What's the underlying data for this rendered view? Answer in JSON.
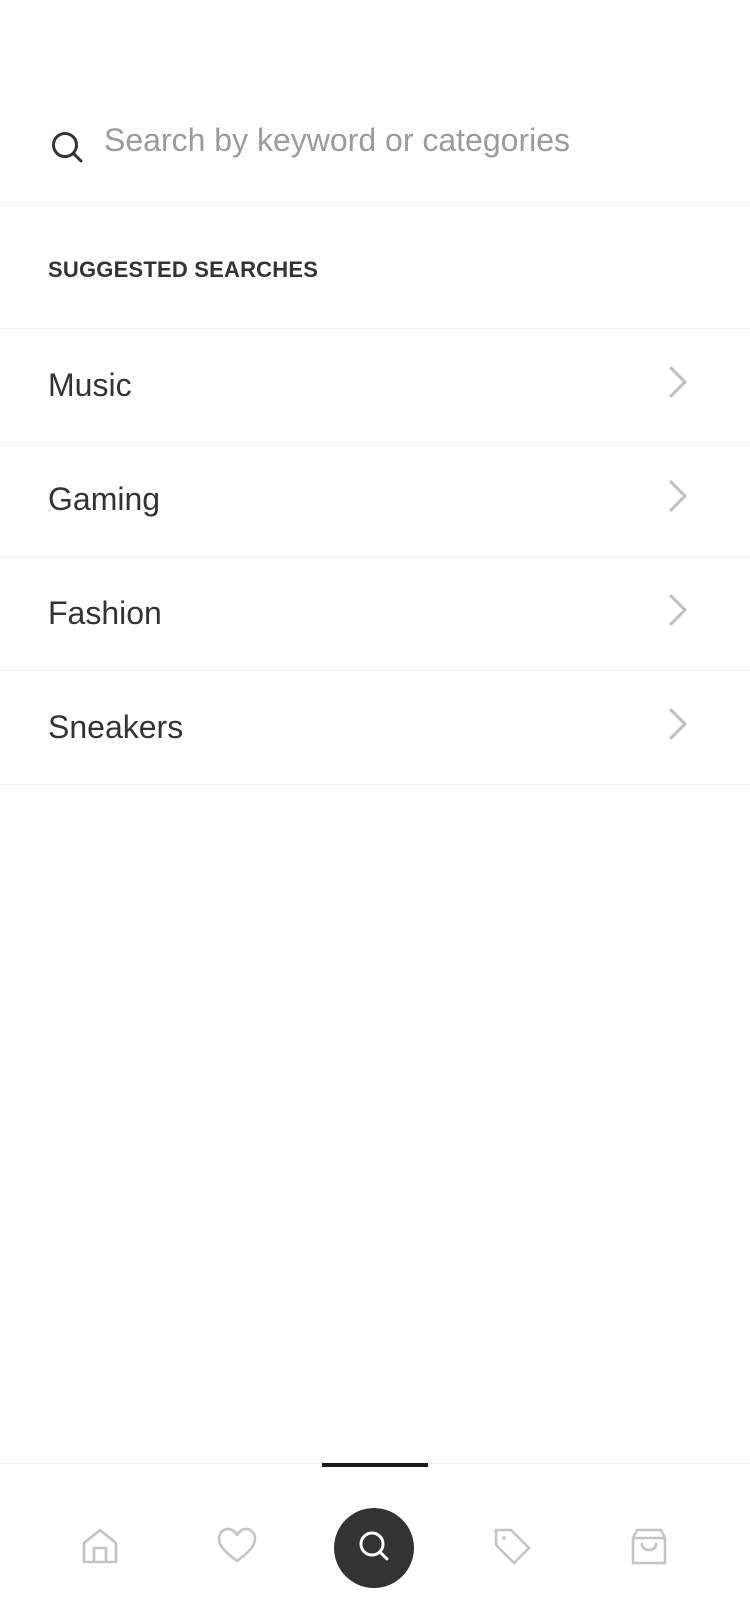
{
  "search": {
    "placeholder": "Search by keyword or categories",
    "value": ""
  },
  "suggested": {
    "title": "SUGGESTED SEARCHES",
    "items": [
      {
        "label": "Music"
      },
      {
        "label": "Gaming"
      },
      {
        "label": "Fashion"
      },
      {
        "label": "Sneakers"
      }
    ]
  },
  "bottom_nav": {
    "items": [
      {
        "icon": "home-icon",
        "active": false
      },
      {
        "icon": "heart-icon",
        "active": false
      },
      {
        "icon": "search-icon",
        "active": true
      },
      {
        "icon": "tag-icon",
        "active": false
      },
      {
        "icon": "shopping-bag-icon",
        "active": false
      }
    ]
  },
  "colors": {
    "text": "#333333",
    "placeholder": "#9b9b9b",
    "divider": "#eeeeee",
    "chevron": "#bfbfbf",
    "nav_icon": "#c4c4c4",
    "nav_active_bg": "#333333",
    "nav_indicator": "#1a1a1a"
  }
}
